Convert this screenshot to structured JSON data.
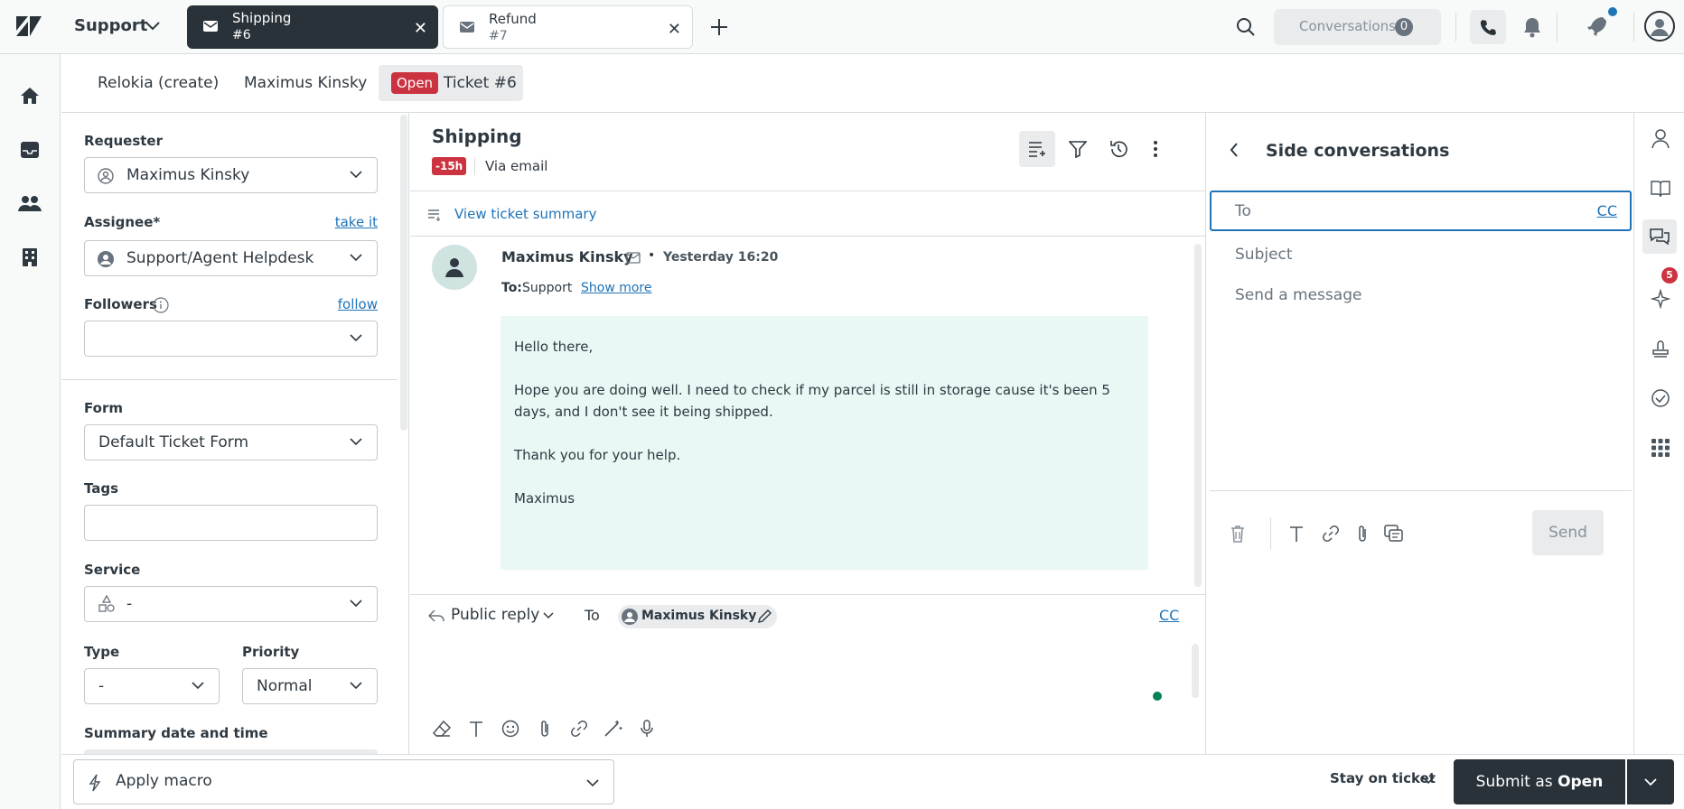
{
  "topbar": {
    "product": "Support",
    "tabs": [
      {
        "title": "Shipping",
        "subtitle": "#6",
        "active": true
      },
      {
        "title": "Refund",
        "subtitle": "#7",
        "active": false
      }
    ],
    "conversations_label": "Conversations",
    "conversations_count": "0"
  },
  "subtabs": {
    "org": "Relokia (create)",
    "user": "Maximus Kinsky",
    "status_badge": "Open",
    "ticket": "Ticket #6"
  },
  "properties": {
    "requester_label": "Requester",
    "requester_value": "Maximus Kinsky",
    "assignee_label": "Assignee*",
    "take_it": "take it",
    "assignee_value": "Support/Agent Helpdesk",
    "followers_label": "Followers",
    "follow": "follow",
    "form_label": "Form",
    "form_value": "Default Ticket Form",
    "tags_label": "Tags",
    "service_label": "Service",
    "service_value": "-",
    "type_label": "Type",
    "type_value": "-",
    "priority_label": "Priority",
    "priority_value": "Normal",
    "summary_label": "Summary date and time"
  },
  "conversation": {
    "title": "Shipping",
    "sla_badge": "-15h",
    "via": "Via email",
    "summary_link": "View ticket summary",
    "message": {
      "author": "Maximus Kinsky",
      "time": "Yesterday 16:20",
      "to_label": "To:",
      "to_value": "Support",
      "show_more": "Show more",
      "body": [
        "Hello there,",
        "Hope you are doing well. I need to check if my parcel is still in storage cause it's been 5 days, and I don't see it being shipped.",
        "Thank you for your help.",
        "Maximus"
      ]
    },
    "reply": {
      "mode": "Public reply",
      "to_label": "To",
      "recipient": "Maximus Kinsky",
      "cc": "CC"
    }
  },
  "side_conversation": {
    "title": "Side conversations",
    "to_placeholder": "To",
    "cc": "CC",
    "subject_placeholder": "Subject",
    "message_placeholder": "Send a message",
    "send": "Send"
  },
  "rightbar": {
    "apps_badge": "5"
  },
  "footer": {
    "apply_macro": "Apply macro",
    "stay_on_ticket": "Stay on ticket",
    "submit_prefix": "Submit as",
    "submit_status": "Open"
  },
  "colors": {
    "dark": "#293239",
    "accent": "#1f73b7",
    "open_badge": "#cc3340",
    "message_bg": "#e9f7f5"
  }
}
